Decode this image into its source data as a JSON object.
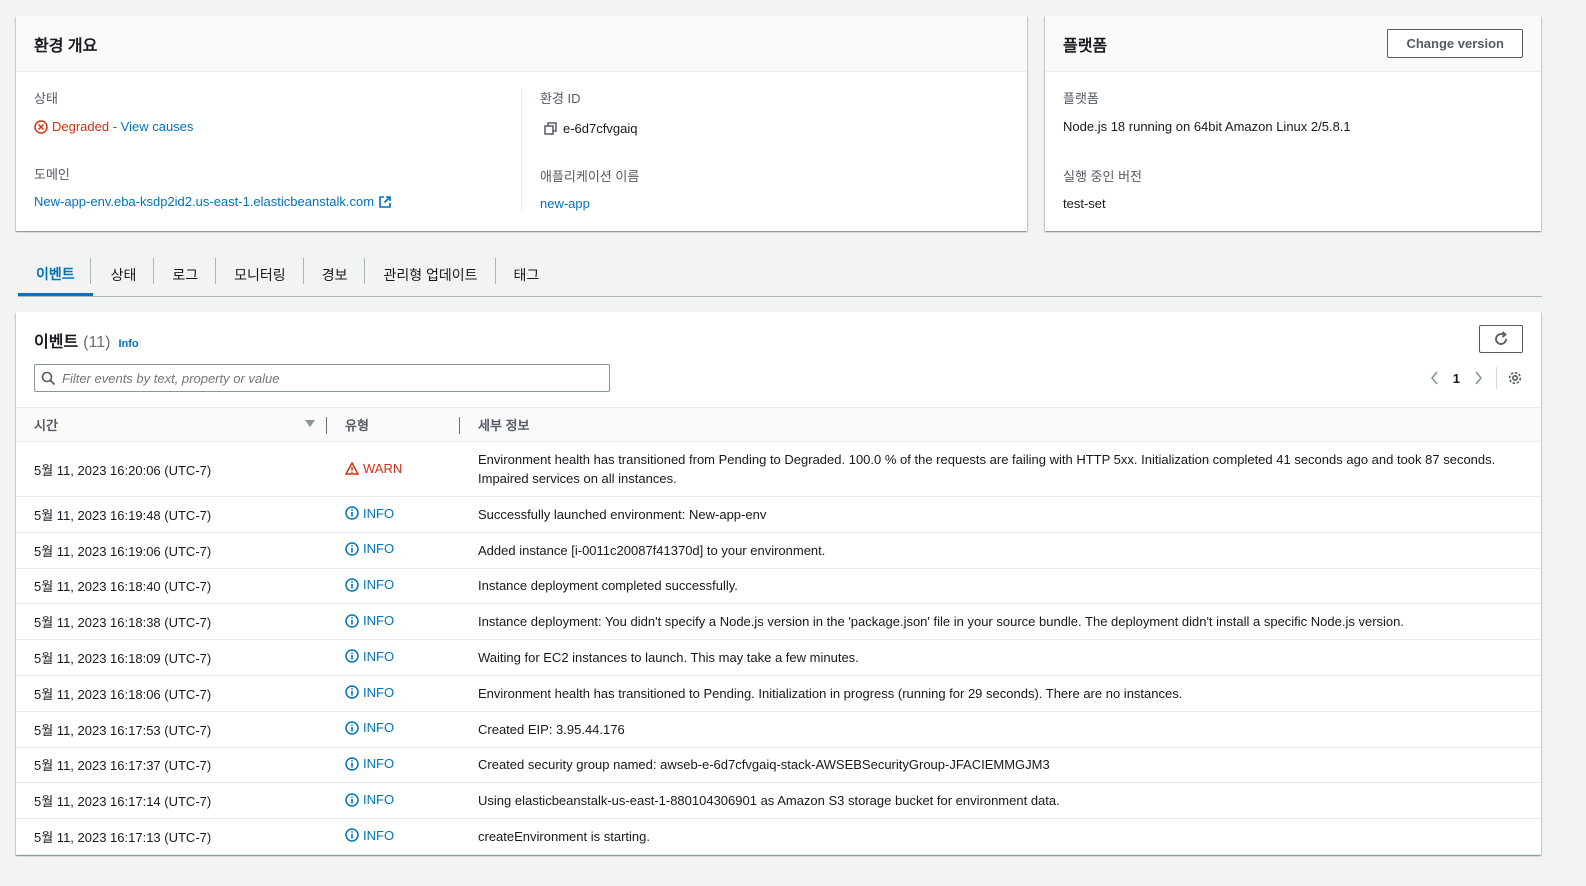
{
  "overview": {
    "title": "환경 개요",
    "status_label": "상태",
    "status_value": "Degraded",
    "status_sep": " - ",
    "view_causes": "View causes",
    "domain_label": "도메인",
    "domain_value": "New-app-env.eba-ksdp2id2.us-east-1.elasticbeanstalk.com",
    "env_id_label": "환경 ID",
    "env_id_value": "e-6d7cfvgaiq",
    "app_name_label": "애플리케이션 이름",
    "app_name_value": "new-app"
  },
  "platform": {
    "title": "플랫폼",
    "change_version": "Change version",
    "platform_label": "플랫폼",
    "platform_value": "Node.js 18 running on 64bit Amazon Linux 2/5.8.1",
    "running_version_label": "실행 중인 버전",
    "running_version_value": "test-set"
  },
  "tabs": [
    "이벤트",
    "상태",
    "로그",
    "모니터링",
    "경보",
    "관리형 업데이트",
    "태그"
  ],
  "events": {
    "title": "이벤트",
    "count": "(11)",
    "info_link": "Info",
    "filter_placeholder": "Filter events by text, property or value",
    "page": "1",
    "columns": {
      "time": "시간",
      "type": "유형",
      "details": "세부 정보"
    },
    "rows": [
      {
        "time": "5월 11, 2023 16:20:06 (UTC-7)",
        "type": "WARN",
        "details": "Environment health has transitioned from Pending to Degraded. 100.0 % of the requests are failing with HTTP 5xx. Initialization completed 41 seconds ago and took 87 seconds.",
        "details2": "Impaired services on all instances."
      },
      {
        "time": "5월 11, 2023 16:19:48 (UTC-7)",
        "type": "INFO",
        "details": "Successfully launched environment: New-app-env"
      },
      {
        "time": "5월 11, 2023 16:19:06 (UTC-7)",
        "type": "INFO",
        "details": "Added instance [i-0011c20087f41370d] to your environment."
      },
      {
        "time": "5월 11, 2023 16:18:40 (UTC-7)",
        "type": "INFO",
        "details": "Instance deployment completed successfully."
      },
      {
        "time": "5월 11, 2023 16:18:38 (UTC-7)",
        "type": "INFO",
        "details": "Instance deployment: You didn't specify a Node.js version in the 'package.json' file in your source bundle. The deployment didn't install a specific Node.js version."
      },
      {
        "time": "5월 11, 2023 16:18:09 (UTC-7)",
        "type": "INFO",
        "details": "Waiting for EC2 instances to launch. This may take a few minutes."
      },
      {
        "time": "5월 11, 2023 16:18:06 (UTC-7)",
        "type": "INFO",
        "details": "Environment health has transitioned to Pending. Initialization in progress (running for 29 seconds). There are no instances."
      },
      {
        "time": "5월 11, 2023 16:17:53 (UTC-7)",
        "type": "INFO",
        "details": "Created EIP: 3.95.44.176"
      },
      {
        "time": "5월 11, 2023 16:17:37 (UTC-7)",
        "type": "INFO",
        "details": "Created security group named: awseb-e-6d7cfvgaiq-stack-AWSEBSecurityGroup-JFACIEMMGJM3"
      },
      {
        "time": "5월 11, 2023 16:17:14 (UTC-7)",
        "type": "INFO",
        "details": "Using elasticbeanstalk-us-east-1-880104306901 as Amazon S3 storage bucket for environment data."
      },
      {
        "time": "5월 11, 2023 16:17:13 (UTC-7)",
        "type": "INFO",
        "details": "createEnvironment is starting."
      }
    ]
  }
}
